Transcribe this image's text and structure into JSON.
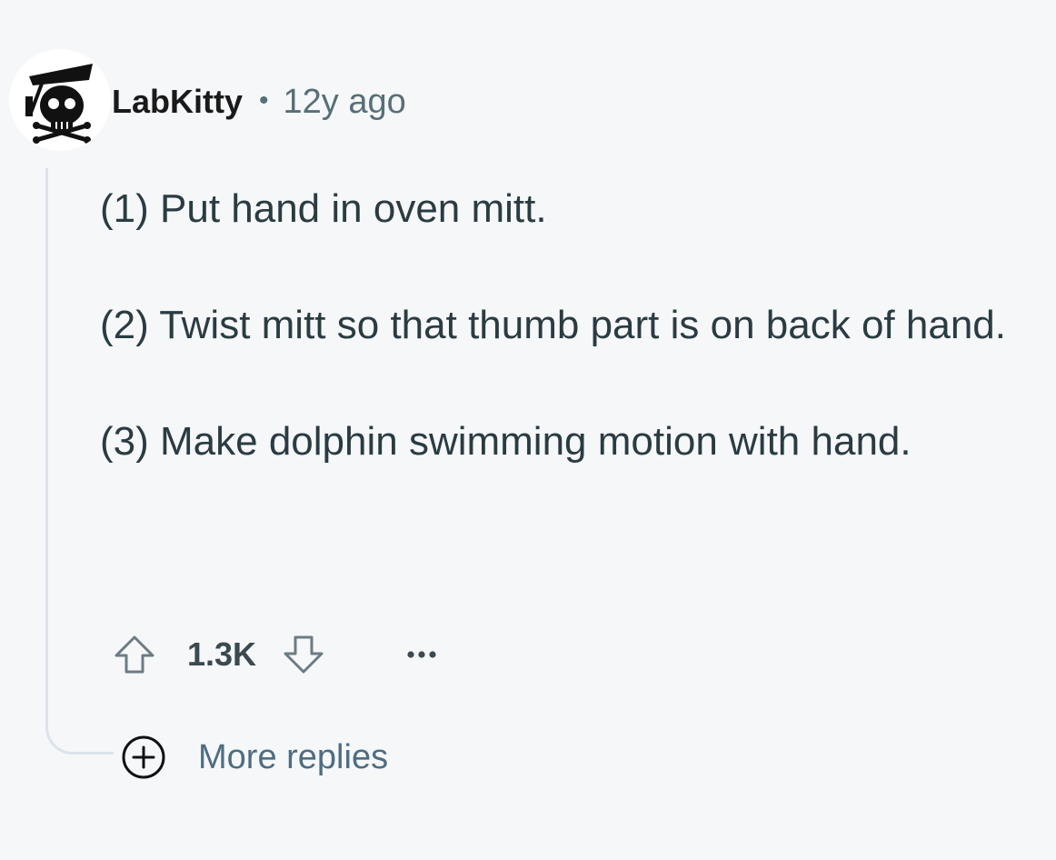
{
  "comment": {
    "username": "LabKitty",
    "separator": "•",
    "timestamp": "12y ago",
    "paragraphs": [
      "(1) Put hand in oven mitt.",
      "(2) Twist mitt so that thumb part is on back of hand.",
      "(3) Make dolphin swimming motion with hand."
    ]
  },
  "actions": {
    "score": "1.3K",
    "upvote_icon": "arrow-up-outline-icon",
    "downvote_icon": "arrow-down-outline-icon",
    "more_icon": "ellipsis-icon"
  },
  "more_replies": {
    "label": "More replies",
    "icon": "plus-circle-icon"
  },
  "colors": {
    "background": "#f6f7f9",
    "text_primary": "#1a1a1b",
    "text_body": "#2a3c42",
    "text_meta": "#576f76",
    "link": "#4e6d82",
    "thread_line": "#dde3ea"
  }
}
